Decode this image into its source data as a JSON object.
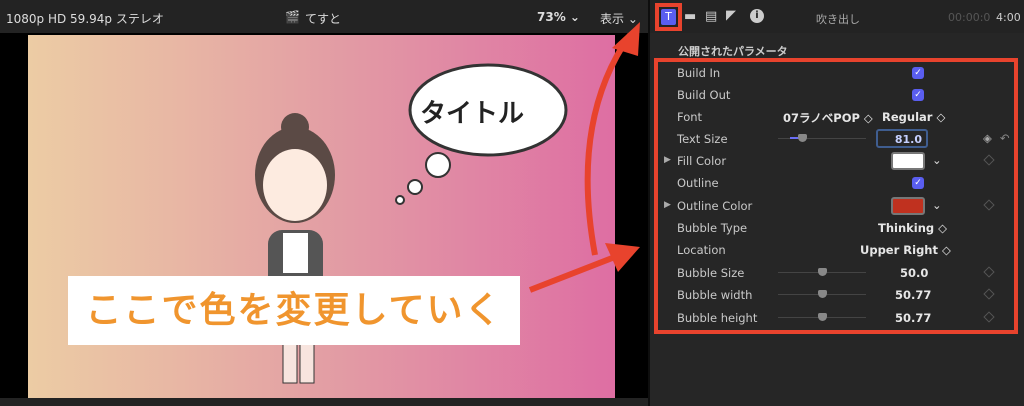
{
  "viewer": {
    "format": "1080p HD 59.94p ステレオ",
    "project": "てすと",
    "zoom": "73%",
    "view_menu": "表示"
  },
  "canvas": {
    "bubble_text": "タイトル",
    "caption": "ここで色を変更していく"
  },
  "inspector": {
    "tab_title": "吹き出し",
    "timecode_dim": "00:00:0",
    "timecode": "4:00",
    "section": "公開されたパラメータ",
    "title_tab_glyph": "T",
    "params": {
      "build_in": {
        "label": "Build In",
        "checked": true
      },
      "build_out": {
        "label": "Build Out",
        "checked": true
      },
      "font": {
        "label": "Font",
        "family": "07ラノベPOP",
        "style": "Regular"
      },
      "text_size": {
        "label": "Text Size",
        "value": "81.0"
      },
      "fill_color": {
        "label": "Fill Color",
        "color": "#ffffff"
      },
      "outline": {
        "label": "Outline",
        "checked": true
      },
      "outline_color": {
        "label": "Outline Color",
        "color": "#c0311f"
      },
      "bubble_type": {
        "label": "Bubble Type",
        "value": "Thinking"
      },
      "location": {
        "label": "Location",
        "value": "Upper Right"
      },
      "bubble_size": {
        "label": "Bubble Size",
        "value": "50.0"
      },
      "bubble_width": {
        "label": "Bubble width",
        "value": "50.77"
      },
      "bubble_height": {
        "label": "Bubble height",
        "value": "50.77"
      }
    }
  },
  "colors": {
    "accent": "#5a5ef0",
    "highlight": "#e8432d",
    "caption": "#f0952e"
  }
}
